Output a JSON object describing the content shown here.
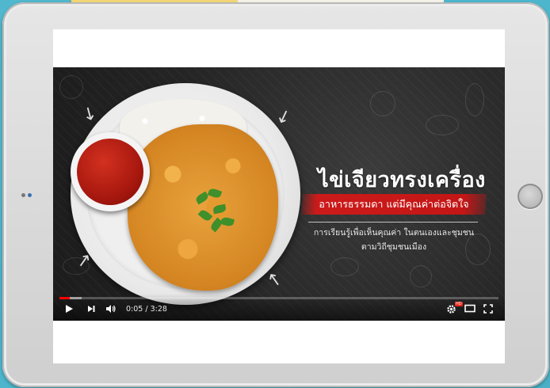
{
  "video": {
    "title_main": "ไข่เจียวทรงเครื่อง",
    "title_sub": "อาหารธรรมดา แต่มีคุณค่าต่อจิตใจ",
    "title_desc_line1": "การเรียนรู้เพื่อเห็นคุณค่า ในตนเองและชุมชน",
    "title_desc_line2": "ตามวิถีชุมชนเมือง"
  },
  "player": {
    "current_time": "0:05",
    "duration": "3:28",
    "time_display": "0:05 / 3:28",
    "progress_fraction": 0.024,
    "buffered_fraction": 0.05,
    "icons": [
      "play-icon",
      "next-icon",
      "volume-icon",
      "settings-icon",
      "theater-mode-icon",
      "fullscreen-icon"
    ],
    "hd_badge": "HD",
    "accent_color": "#ff0000"
  },
  "colors": {
    "background": "#4db6cd",
    "tablet_frame": "#dcdcdc",
    "title_bar": "#c41616"
  }
}
